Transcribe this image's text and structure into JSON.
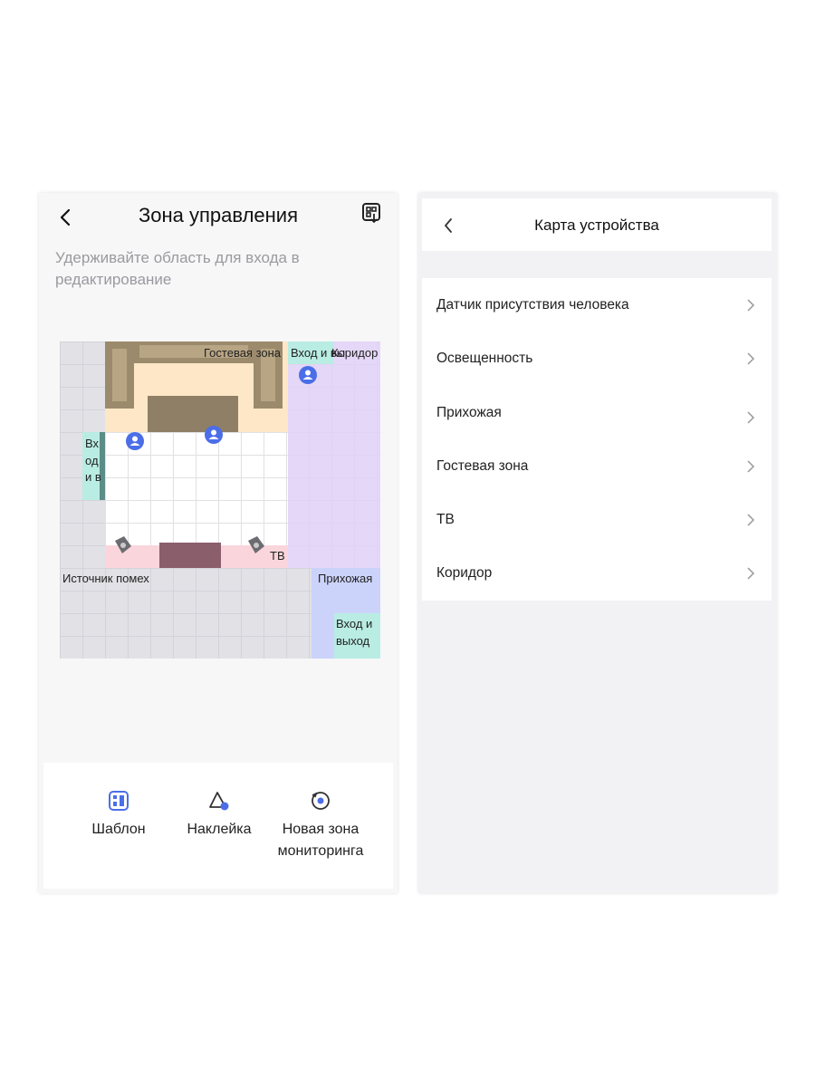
{
  "left_screen": {
    "title": "Зона управления",
    "back_icon": "chevron-left-icon",
    "scan_icon": "qr-scan-icon",
    "hint": "Удерживайте область для входа в редактирование",
    "map": {
      "zones": {
        "guest_zone": "Гостевая зона",
        "entrance_top": "Вход и вы",
        "corridor": "Коридор",
        "entrance_left_line1": "Вх",
        "entrance_left_line2": "од",
        "entrance_left_line3": "и в",
        "tv": "ТВ",
        "interference": "Источник помех",
        "hallway": "Прихожая",
        "entrance_bottom_line1": "Вход и",
        "entrance_bottom_line2": "выход"
      },
      "colors": {
        "guest": "#fde7c7",
        "entrance": "#b9ece3",
        "corridor": "#e9dbf7",
        "tv": "#fbd5dc",
        "interference": "#e4e4ea",
        "hallway": "#cbd3fb",
        "person": "#4b6ee8"
      }
    },
    "toolbar": {
      "template": {
        "label": "Шаблон",
        "icon": "template-icon"
      },
      "sticker": {
        "label": "Наклейка",
        "icon": "sticker-icon"
      },
      "new_zone": {
        "label_line1": "Новая зона",
        "label_line2": "мониторинга",
        "icon": "new-zone-icon"
      }
    }
  },
  "right_screen": {
    "title": "Карта устройства",
    "back_icon": "chevron-left-icon",
    "items": [
      {
        "label": "Датчик присутствия человека"
      },
      {
        "label": "Освещенность"
      },
      {
        "label": "Прихожая"
      },
      {
        "label": "Гостевая зона"
      },
      {
        "label": "ТВ"
      },
      {
        "label": "Коридор"
      }
    ]
  }
}
